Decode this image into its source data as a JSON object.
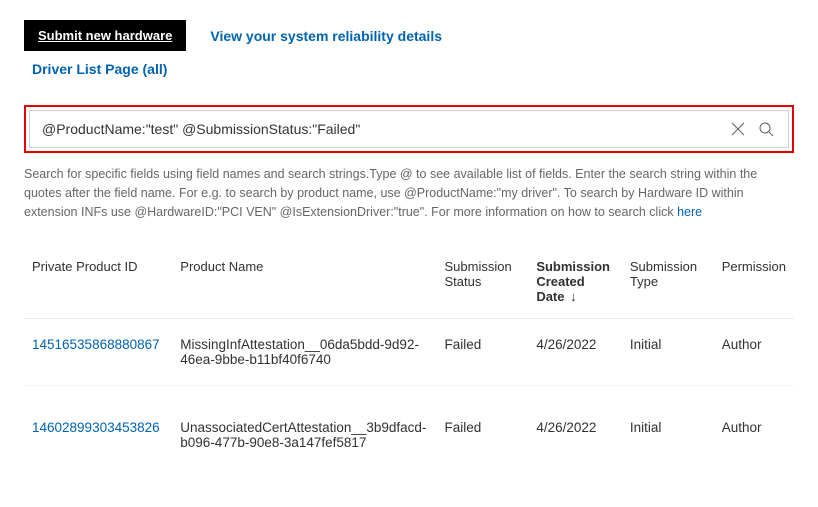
{
  "actions": {
    "submit_label": "Submit new hardware",
    "reliability_link": "View your system reliability details",
    "driver_list_link": "Driver List Page (all)"
  },
  "search": {
    "value": "@ProductName:\"test\" @SubmissionStatus:\"Failed\""
  },
  "help": {
    "line1": "Search for specific fields using field names and search strings.Type @ to see available list of fields. Enter the search string within the quotes after the field name. For e.g. to search by product name, use @ProductName:\"my driver\". To search by Hardware ID within extension INFs use @HardwareID:\"PCI VEN\" @IsExtensionDriver:\"true\". For more information on how to search click ",
    "here": "here"
  },
  "table": {
    "columns": {
      "id": "Private Product ID",
      "name": "Product Name",
      "status": "Submission Status",
      "date": "Submission Created Date",
      "type": "Submission Type",
      "perm": "Permission"
    },
    "sort_indicator": "↓",
    "rows": [
      {
        "id": "14516535868880867",
        "name": "MissingInfAttestation__06da5bdd-9d92-46ea-9bbe-b11bf40f6740",
        "status": "Failed",
        "date": "4/26/2022",
        "type": "Initial",
        "perm": "Author"
      },
      {
        "id": "14602899303453826",
        "name": "UnassociatedCertAttestation__3b9dfacd-b096-477b-90e8-3a147fef5817",
        "status": "Failed",
        "date": "4/26/2022",
        "type": "Initial",
        "perm": "Author"
      }
    ]
  }
}
